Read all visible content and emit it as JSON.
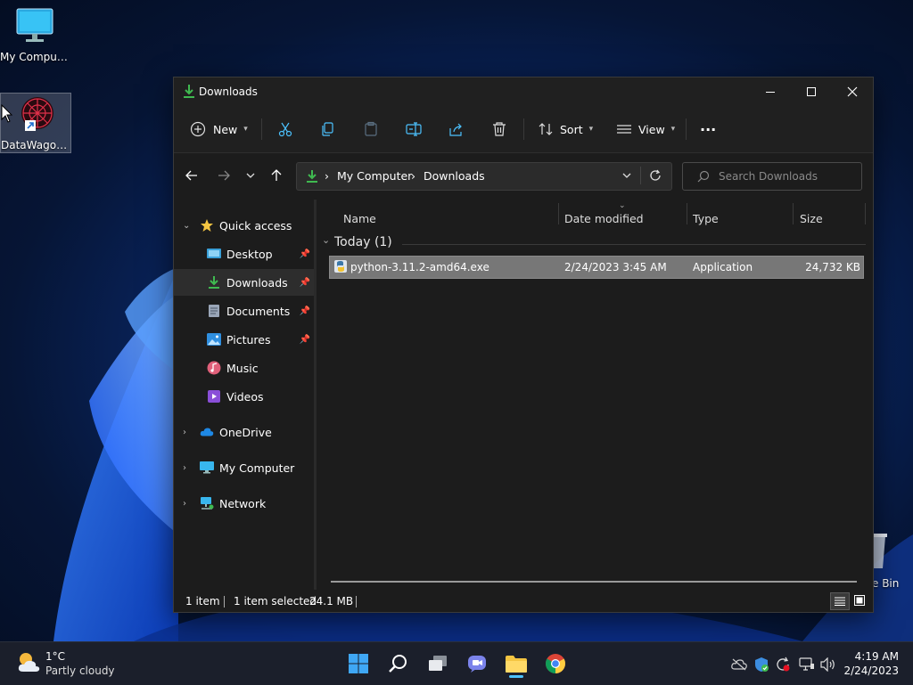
{
  "desktop": {
    "icons": [
      {
        "label": "My Computer"
      },
      {
        "label": "DataWagon..."
      },
      {
        "label": "e Bin"
      }
    ]
  },
  "window": {
    "title": "Downloads",
    "toolbar": {
      "new_label": "New",
      "sort_label": "Sort",
      "view_label": "View",
      "more_label": "···"
    },
    "address": {
      "crumbs": [
        "My Computer",
        "Downloads"
      ],
      "separator": "›"
    },
    "search": {
      "placeholder": "Search Downloads"
    },
    "sidebar": {
      "items": [
        {
          "label": "Quick access"
        },
        {
          "label": "Desktop"
        },
        {
          "label": "Downloads"
        },
        {
          "label": "Documents"
        },
        {
          "label": "Pictures"
        },
        {
          "label": "Music"
        },
        {
          "label": "Videos"
        },
        {
          "label": "OneDrive"
        },
        {
          "label": "My Computer"
        },
        {
          "label": "Network"
        }
      ]
    },
    "columns": {
      "name": "Name",
      "date_modified": "Date modified",
      "type": "Type",
      "size": "Size"
    },
    "group": {
      "title": "Today (1)"
    },
    "files": [
      {
        "name": "python-3.11.2-amd64.exe",
        "date": "2/24/2023 3:45 AM",
        "type": "Application",
        "size": "24,732 KB"
      }
    ],
    "status": {
      "count": "1 item",
      "selected": "1 item selected",
      "size": "24.1 MB"
    }
  },
  "taskbar": {
    "weather": {
      "temp": "1°C",
      "condition": "Partly cloudy"
    },
    "clock": {
      "time": "4:19 AM",
      "date": "2/24/2023"
    }
  },
  "colors": {
    "accent": "#4cc2ff",
    "download_green": "#3fb950",
    "folder_yellow": "#f4c542",
    "selection_row": "#777777"
  }
}
